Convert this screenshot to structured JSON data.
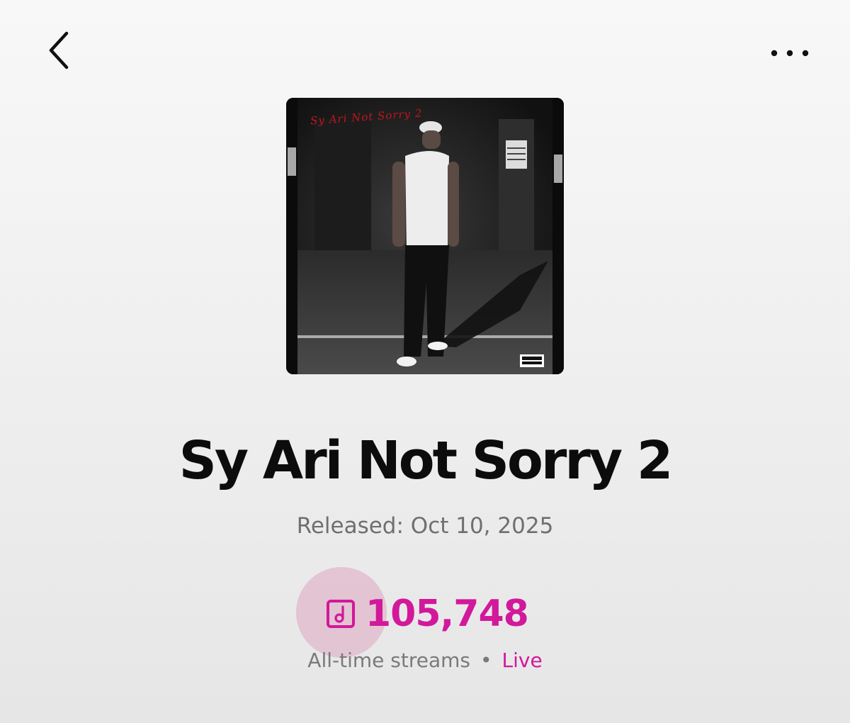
{
  "header": {
    "back_icon": "chevron-left-icon",
    "more_icon": "more-horizontal-icon"
  },
  "album": {
    "cover_title_text": "Sy Ari Not Sorry 2",
    "title": "Sy Ari Not Sorry 2",
    "released": "Released: Oct 10, 2025"
  },
  "streams": {
    "icon": "music-note-icon",
    "count": "105,748",
    "label": "All-time streams",
    "separator": "•",
    "live_label": "Live"
  },
  "colors": {
    "accent": "#d2189b",
    "title": "#0c0c0c",
    "secondary_text": "#6f6f6f"
  }
}
